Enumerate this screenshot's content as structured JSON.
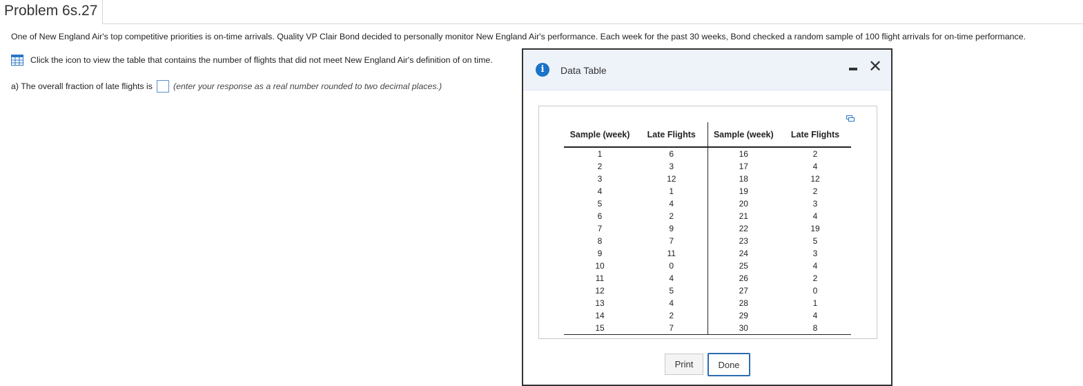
{
  "page": {
    "title": "Problem 6s.27",
    "problem_text": "One of New England Air's top competitive priorities is on-time arrivals. Quality VP Clair Bond decided to personally monitor New England Air's performance. Each week for the past 30 weeks, Bond checked a random sample of 100 flight arrivals for on-time performance.",
    "table_link_text": "Click the icon to view the table that contains the number of flights that did not meet New England Air's definition of on time.",
    "question_label": "a) The overall fraction of late flights is",
    "answer_value": "",
    "question_hint": "(enter your response as a real number rounded to two decimal places.)"
  },
  "modal": {
    "title": "Data Table",
    "minimize_icon": "minimize-icon",
    "close_icon": "close-icon",
    "print_label": "Print",
    "done_label": "Done",
    "columns": [
      "Sample (week)",
      "Late Flights",
      "Sample (week)",
      "Late Flights"
    ],
    "rows": [
      [
        "1",
        "6",
        "16",
        "2"
      ],
      [
        "2",
        "3",
        "17",
        "4"
      ],
      [
        "3",
        "12",
        "18",
        "12"
      ],
      [
        "4",
        "1",
        "19",
        "2"
      ],
      [
        "5",
        "4",
        "20",
        "3"
      ],
      [
        "6",
        "2",
        "21",
        "4"
      ],
      [
        "7",
        "9",
        "22",
        "19"
      ],
      [
        "8",
        "7",
        "23",
        "5"
      ],
      [
        "9",
        "11",
        "24",
        "3"
      ],
      [
        "10",
        "0",
        "25",
        "4"
      ],
      [
        "11",
        "4",
        "26",
        "2"
      ],
      [
        "12",
        "5",
        "27",
        "0"
      ],
      [
        "13",
        "4",
        "28",
        "1"
      ],
      [
        "14",
        "2",
        "29",
        "4"
      ],
      [
        "15",
        "7",
        "30",
        "8"
      ]
    ]
  },
  "colors": {
    "accent": "#1a73c8",
    "modal_header_bg": "#eef3fa",
    "input_border": "#5b8fcb"
  }
}
